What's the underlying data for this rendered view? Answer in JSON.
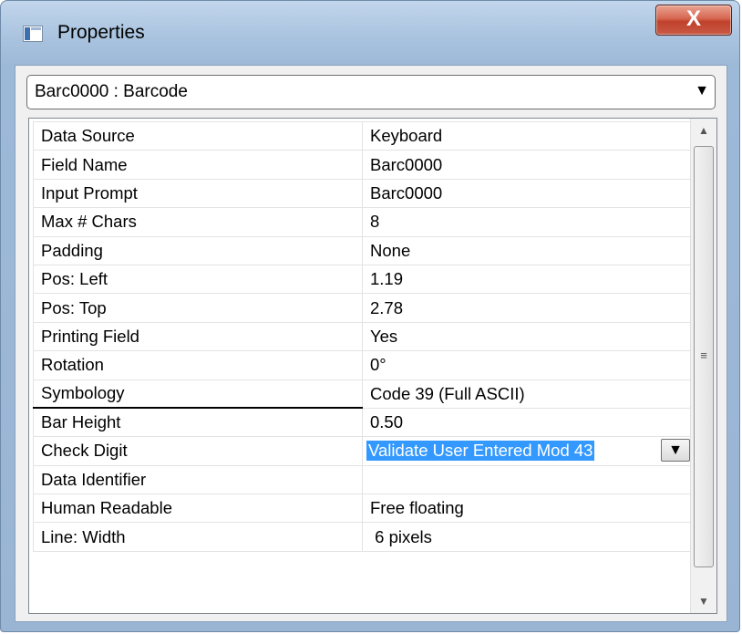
{
  "window": {
    "title": "Properties",
    "close_label": "X"
  },
  "object_selector": {
    "selected": "Barc0000 : Barcode"
  },
  "properties": [
    {
      "name": "Data Source",
      "value": "Keyboard"
    },
    {
      "name": "Field Name",
      "value": "Barc0000"
    },
    {
      "name": "Input Prompt",
      "value": "Barc0000"
    },
    {
      "name": "Max # Chars",
      "value": "8"
    },
    {
      "name": "Padding",
      "value": "None"
    },
    {
      "name": "Pos: Left",
      "value": "1.19"
    },
    {
      "name": "Pos: Top",
      "value": "2.78"
    },
    {
      "name": "Printing Field",
      "value": "Yes"
    },
    {
      "name": "Rotation",
      "value": "0°"
    },
    {
      "name": "Symbology",
      "value": "Code 39 (Full ASCII)"
    },
    {
      "name": "Bar Height",
      "value": "0.50"
    },
    {
      "name": "Check Digit",
      "value": "Validate User Entered Mod 43"
    },
    {
      "name": "Data Identifier",
      "value": ""
    },
    {
      "name": "Human Readable",
      "value": "Free floating"
    },
    {
      "name": "Line:  Width",
      "value": " 6 pixels"
    }
  ],
  "icons": {
    "app": "properties-window-icon",
    "dropdown": "chevron-down-icon",
    "scroll_up": "scroll-up-arrow-icon",
    "scroll_down": "scroll-down-arrow-icon",
    "grip": "scroll-grip-icon"
  },
  "colors": {
    "selection": "#3399ff",
    "close_button": "#c9503a"
  }
}
